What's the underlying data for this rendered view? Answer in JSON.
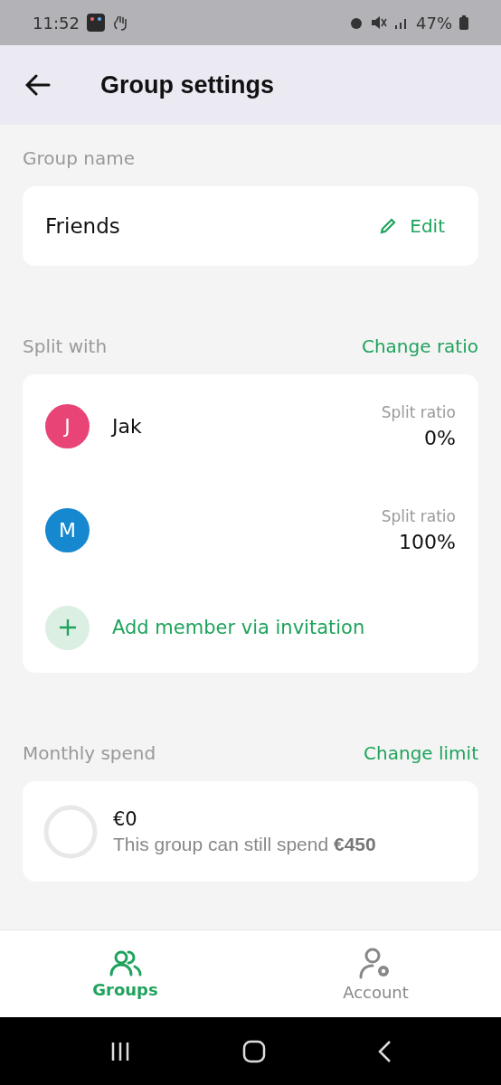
{
  "status_bar": {
    "time": "11:52",
    "battery": "47%"
  },
  "header": {
    "title": "Group settings"
  },
  "group_name": {
    "label": "Group name",
    "value": "Friends",
    "action": "Edit"
  },
  "split": {
    "label": "Split with",
    "action": "Change ratio",
    "members": [
      {
        "initial": "J",
        "color": "#e94476",
        "name": "Jak",
        "ratio_label": "Split ratio",
        "ratio": "0%"
      },
      {
        "initial": "M",
        "color": "#1588d0",
        "ratio_label": "Split ratio",
        "ratio": "100%"
      }
    ],
    "add_label": "Add member via invitation"
  },
  "monthly": {
    "label": "Monthly spend",
    "action": "Change limit",
    "amount": "€0",
    "note": "This group can still spend **€450**",
    "level": 0
  },
  "nav": [
    {
      "label": "Groups",
      "kind": "groups",
      "selected": true
    },
    {
      "label": "Account",
      "kind": "account",
      "selected": false
    }
  ]
}
